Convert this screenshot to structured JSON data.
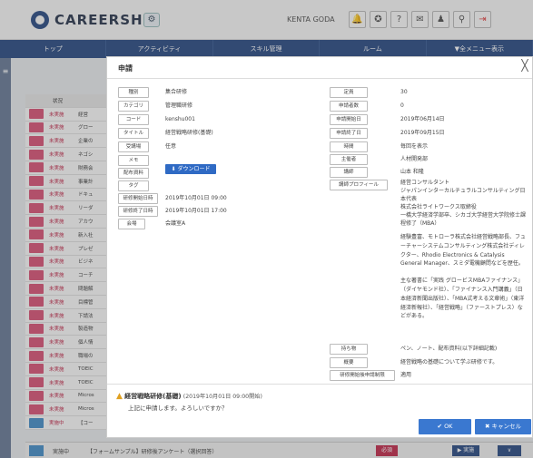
{
  "header": {
    "logo_text": "CAREERSHIP",
    "username": "KENTA GODA",
    "icons": [
      "bell-icon",
      "badge-icon",
      "help-icon",
      "mail-icon",
      "person-icon",
      "search-icon",
      "logout-icon"
    ]
  },
  "nav": {
    "items": [
      "トップ",
      "アクティビティ",
      "スキル管理",
      "ルーム",
      "▼全メニュー表示"
    ]
  },
  "background_table": {
    "header_label": "状況",
    "rows": [
      {
        "status": "未実施",
        "title": "経営"
      },
      {
        "status": "未実施",
        "title": "グロー"
      },
      {
        "status": "未実施",
        "title": "企業の"
      },
      {
        "status": "未実施",
        "title": "ネゴシ"
      },
      {
        "status": "未実施",
        "title": "財務会"
      },
      {
        "status": "未実施",
        "title": "事業計"
      },
      {
        "status": "未実施",
        "title": "ドキュ"
      },
      {
        "status": "未実施",
        "title": "リーダ"
      },
      {
        "status": "未実施",
        "title": "アカウ"
      },
      {
        "status": "未実施",
        "title": "新入社"
      },
      {
        "status": "未実施",
        "title": "プレゼ"
      },
      {
        "status": "未実施",
        "title": "ビジネ"
      },
      {
        "status": "未実施",
        "title": "コーチ"
      },
      {
        "status": "未実施",
        "title": "問題解"
      },
      {
        "status": "未実施",
        "title": "目標管"
      },
      {
        "status": "未実施",
        "title": "下請法"
      },
      {
        "status": "未実施",
        "title": "製造物"
      },
      {
        "status": "未実施",
        "title": "個人情"
      },
      {
        "status": "未実施",
        "title": "職場の"
      },
      {
        "status": "未実施",
        "title": "TOEIC"
      },
      {
        "status": "未実施",
        "title": "TOEIC"
      },
      {
        "status": "未実施",
        "title": "Micros"
      },
      {
        "status": "未実施",
        "title": "Micros"
      },
      {
        "status": "実施中",
        "title": "【コー"
      }
    ],
    "bottom": {
      "status": "実施中",
      "title": "【フォームサンプル】研修後アンケート（選択回答）",
      "badge": "必須",
      "btn1": "▶ 実施",
      "btn2": "∨"
    }
  },
  "modal": {
    "title": "申請",
    "close": "╳",
    "left_fields": [
      {
        "label": "種別",
        "value": "集合研修"
      },
      {
        "label": "カテゴリ",
        "value": "管理職研修"
      },
      {
        "label": "コード",
        "value": "kenshu001"
      },
      {
        "label": "タイトル",
        "value": "経営戦略研修(基礎)"
      },
      {
        "label": "受講場",
        "value": "任意"
      },
      {
        "label": "メモ",
        "value": ""
      },
      {
        "label": "配布資料",
        "value": ""
      },
      {
        "label": "タグ",
        "value": ""
      },
      {
        "label": "研修開始日時",
        "value": "2019年10月01日 09:00"
      },
      {
        "label": "研修終了日時",
        "value": "2019年10月01日 17:00"
      },
      {
        "label": "会場",
        "value": "会議室A"
      }
    ],
    "download_label": "ダウンロード",
    "right_fields": [
      {
        "label": "定員",
        "value": "30"
      },
      {
        "label": "申請者数",
        "value": "0"
      },
      {
        "label": "申請開始日",
        "value": "2019年06月14日"
      },
      {
        "label": "申請終了日",
        "value": "2019年09月15日"
      },
      {
        "label": "時間",
        "value": "毎回を表示"
      },
      {
        "label": "主催者",
        "value": "人材開発部"
      },
      {
        "label": "講師",
        "value": "山本 和隆"
      },
      {
        "label": "講師プロフィール",
        "value": "経営コンサルタント"
      }
    ],
    "profile_lines": [
      "ジャパンインターカルチュラルコンサルティング日本代表",
      "株式会社ライトワークス取締役",
      "一橋大学経済学部卒、シカゴ大学経営大学院修士課程修了（MBA）",
      "",
      "経験豊富、モトローラ株式会社経営戦略部長、フューチャーシステムコンサルティング株式会社ディレクター、Rhodio Electronics & Catalysis General Manager、スミダ電機顧問などを歴任。",
      "主な著書に「実践 グロービスMBAファイナンス」（ダイヤモンド社）、「ファイナンス入門講義」（日本経済新聞出版社）、「MBA式考える文章術」（東洋経済新報社）、「経営戦略」（ファーストプレス）などがある。"
    ],
    "bottom_right_fields": [
      {
        "label": "持ち物",
        "value": "ペン、ノート、配布資料(以下詳細記載)"
      },
      {
        "label": "概要",
        "value": "経営戦略の基礎について学ぶ研修です。"
      },
      {
        "label": "研修開始後申請制限",
        "value": "適用"
      }
    ],
    "warning_title": "経営戦略研修(基礎)",
    "warning_paren": "(2019年10月01日 09:00開始)",
    "confirm_text": "上記に申請します。よろしいですか？",
    "ok_label": "OK",
    "cancel_label": "キャンセル"
  }
}
